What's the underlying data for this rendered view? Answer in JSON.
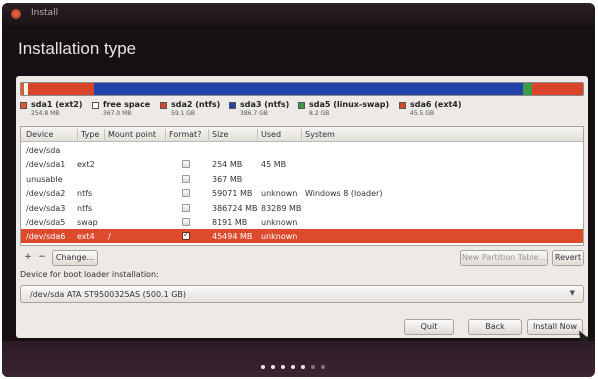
{
  "window": {
    "title": "Install"
  },
  "page": {
    "title": "Installation type"
  },
  "disk_bar": {
    "segments": [
      {
        "color": "#e05a2a",
        "share": 0.25
      },
      {
        "color": "#f2f2f2",
        "share": 0.37
      },
      {
        "color": "#d8442a",
        "share": 5.91
      },
      {
        "color": "#2244aa",
        "share": 38.67
      },
      {
        "color": "#3d9a44",
        "share": 0.82
      },
      {
        "color": "#d8442a",
        "share": 4.55
      }
    ]
  },
  "legend": [
    {
      "name": "sda1 (ext2)",
      "size": "254.8 MB",
      "color": "#e05a2a"
    },
    {
      "name": "free space",
      "size": "367.0 MB",
      "color": "#ffffff"
    },
    {
      "name": "sda2 (ntfs)",
      "size": "59.1 GB",
      "color": "#d8442a"
    },
    {
      "name": "sda3 (ntfs)",
      "size": "386.7 GB",
      "color": "#2244aa"
    },
    {
      "name": "sda5 (linux-swap)",
      "size": "8.2 GB",
      "color": "#3d9a44"
    },
    {
      "name": "sda6 (ext4)",
      "size": "45.5 GB",
      "color": "#d8442a"
    }
  ],
  "table": {
    "columns": [
      "Device",
      "Type",
      "Mount point",
      "Format?",
      "Size",
      "Used",
      "System"
    ],
    "rows": [
      {
        "device": "/dev/sda",
        "type": "",
        "mount": "",
        "format": null,
        "size": "",
        "used": "",
        "system": ""
      },
      {
        "device": "/dev/sda1",
        "type": "ext2",
        "mount": "",
        "format": false,
        "size": "254 MB",
        "used": "45 MB",
        "system": ""
      },
      {
        "device": "unusable",
        "type": "",
        "mount": "",
        "format": false,
        "size": "367 MB",
        "used": "",
        "system": ""
      },
      {
        "device": "/dev/sda2",
        "type": "ntfs",
        "mount": "",
        "format": false,
        "size": "59071 MB",
        "used": "unknown",
        "system": "Windows 8 (loader)"
      },
      {
        "device": "/dev/sda3",
        "type": "ntfs",
        "mount": "",
        "format": false,
        "size": "386724 MB",
        "used": "83289 MB",
        "system": ""
      },
      {
        "device": "/dev/sda5",
        "type": "swap",
        "mount": "",
        "format": false,
        "size": "8191 MB",
        "used": "unknown",
        "system": ""
      },
      {
        "device": "/dev/sda6",
        "type": "ext4",
        "mount": "/",
        "format": true,
        "size": "45494 MB",
        "used": "unknown",
        "system": "",
        "selected": true
      }
    ]
  },
  "toolbar": {
    "add_label": "+",
    "remove_label": "−",
    "change_label": "Change...",
    "new_table_label": "New Partition Table...",
    "revert_label": "Revert"
  },
  "boot": {
    "label": "Device for boot loader installation:",
    "selected": "/dev/sda   ATA ST9500325AS (500.1 GB)"
  },
  "actions": {
    "quit": "Quit",
    "back": "Back",
    "install": "Install Now"
  },
  "progress": {
    "total_steps": 7,
    "current_step": 5
  }
}
